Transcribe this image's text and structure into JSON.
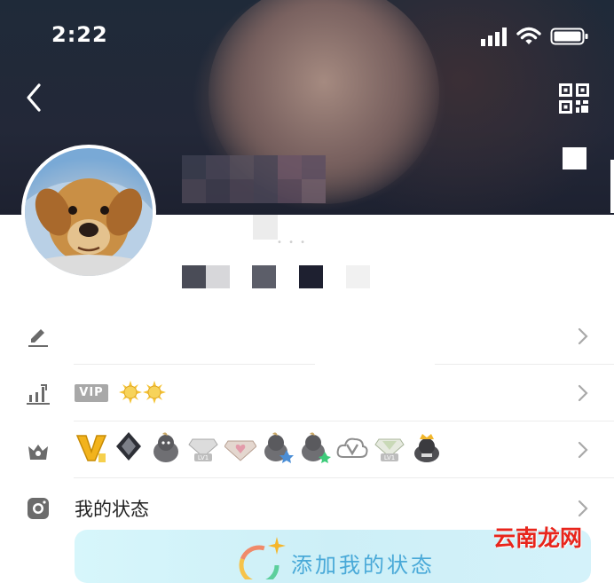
{
  "status_bar": {
    "time": "2:22"
  },
  "icons": {
    "back": "chevron-left-icon",
    "qr": "qr-code-icon",
    "edit": "pencil-icon",
    "level": "bar-chart-icon",
    "crown": "crown-icon",
    "status": "camera-icon",
    "chevron": "chevron-right-icon"
  },
  "vip": {
    "label": "VIP"
  },
  "status_row": {
    "label": "我的状态"
  },
  "add_status": {
    "label": "添加我的状态"
  },
  "watermark": {
    "text": "云南龙网"
  },
  "colors": {
    "accent_text": "#49a9d8",
    "watermark": "#e8251c",
    "vip_tag": "#a8a8a8"
  }
}
